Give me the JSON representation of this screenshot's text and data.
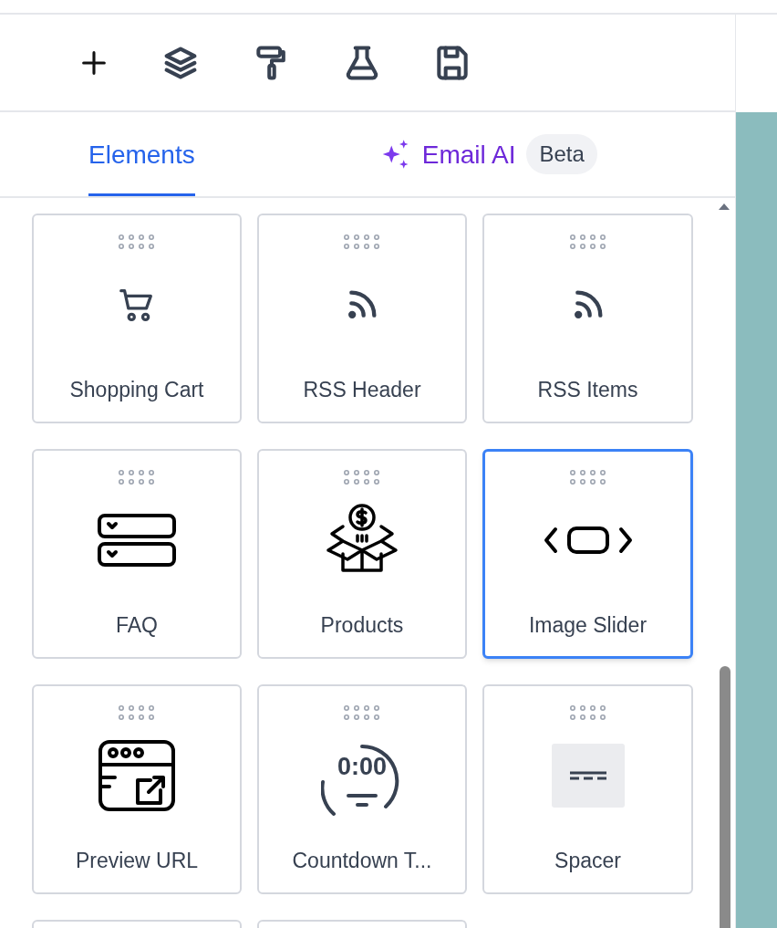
{
  "toolbar": {
    "buttons": [
      {
        "kind": "plus"
      },
      {
        "kind": "layers"
      },
      {
        "kind": "roller"
      },
      {
        "kind": "flask"
      },
      {
        "kind": "save"
      }
    ]
  },
  "tabs": [
    {
      "label": "Elements",
      "kind": "plain",
      "selected": true
    },
    {
      "label": "Email AI",
      "kind": "ai",
      "badge": "Beta",
      "selected": false
    }
  ],
  "elements": [
    {
      "label": "Shopping Cart",
      "kind": "cart",
      "selected": false
    },
    {
      "label": "RSS Header",
      "kind": "rss",
      "selected": false
    },
    {
      "label": "RSS Items",
      "kind": "rss",
      "selected": false
    },
    {
      "label": "FAQ",
      "kind": "faq",
      "selected": false
    },
    {
      "label": "Products",
      "kind": "products",
      "selected": false
    },
    {
      "label": "Image Slider",
      "kind": "slider",
      "selected": true
    },
    {
      "label": "Preview URL",
      "kind": "preview",
      "selected": false
    },
    {
      "label": "Countdown T...",
      "kind": "countdown",
      "selected": false
    },
    {
      "label": "Spacer",
      "kind": "spacer",
      "selected": false
    },
    {
      "kind": "cut_off",
      "selected": false
    },
    {
      "kind": "cut_off",
      "selected": false
    }
  ],
  "timer_icon_text": "0:00"
}
